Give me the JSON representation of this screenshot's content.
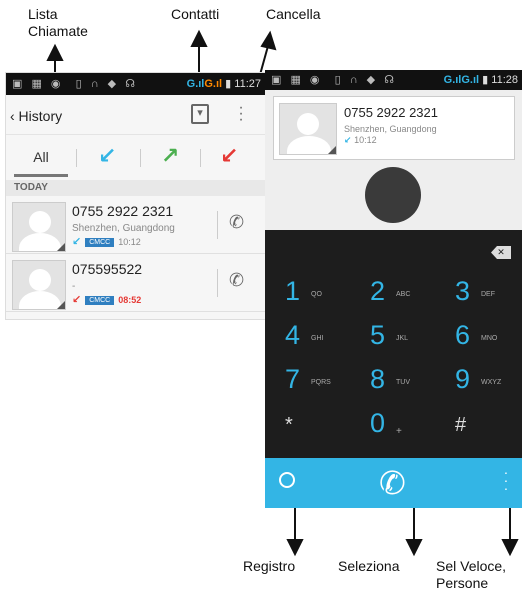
{
  "annotations": {
    "lista": "Lista\nChiamate",
    "contatti": "Contatti",
    "cancella": "Cancella",
    "registro": "Registro",
    "seleziona": "Seleziona",
    "sel_veloce": "Sel Veloce,\nPersone"
  },
  "left_phone": {
    "status_time": "11:27",
    "back_title": "‹ History",
    "contacts_icon": "contacts-icon",
    "more_icon": "more-vert-icon",
    "tabs": [
      {
        "label": "All"
      },
      {
        "icon": "incoming-arrow-icon",
        "glyph": "↙",
        "color": "#33b5e5"
      },
      {
        "icon": "outgoing-arrow-icon",
        "glyph": "↗",
        "color": "#4caf50"
      },
      {
        "icon": "missed-arrow-icon",
        "glyph": "↙",
        "color": "#e53935"
      }
    ],
    "section": "TODAY",
    "calls": [
      {
        "number": "0755 2922 2321",
        "location": "Shenzhen, Guangdong",
        "direction_glyph": "↙",
        "direction_color": "#33b5e5",
        "carrier": "CMCC",
        "time": "10:12",
        "time_color": "#888888"
      },
      {
        "number": "075595522",
        "location": "-",
        "direction_glyph": "↙",
        "direction_color": "#e53935",
        "carrier": "CMCC",
        "time": "08:52",
        "time_color": "#e53935"
      }
    ]
  },
  "right_phone": {
    "status_time": "11:28",
    "card_number": "0755 2922 2321",
    "card_location": "Shenzhen, Guangdong",
    "card_time": "10:12",
    "keys": [
      {
        "digit": "1",
        "letters": "QO",
        "color": "#33b5e5"
      },
      {
        "digit": "2",
        "letters": "ABC",
        "color": "#33b5e5"
      },
      {
        "digit": "3",
        "letters": "DEF",
        "color": "#33b5e5"
      },
      {
        "digit": "4",
        "letters": "GHI",
        "color": "#33b5e5"
      },
      {
        "digit": "5",
        "letters": "JKL",
        "color": "#33b5e5"
      },
      {
        "digit": "6",
        "letters": "MNO",
        "color": "#33b5e5"
      },
      {
        "digit": "7",
        "letters": "PQRS",
        "color": "#33b5e5"
      },
      {
        "digit": "8",
        "letters": "TUV",
        "color": "#33b5e5"
      },
      {
        "digit": "9",
        "letters": "WXYZ",
        "color": "#33b5e5"
      },
      {
        "digit": "*",
        "letters": "",
        "color": "#dddddd"
      },
      {
        "digit": "0",
        "letters": "+",
        "color": "#33b5e5"
      },
      {
        "digit": "#",
        "letters": "",
        "color": "#dddddd"
      }
    ]
  }
}
